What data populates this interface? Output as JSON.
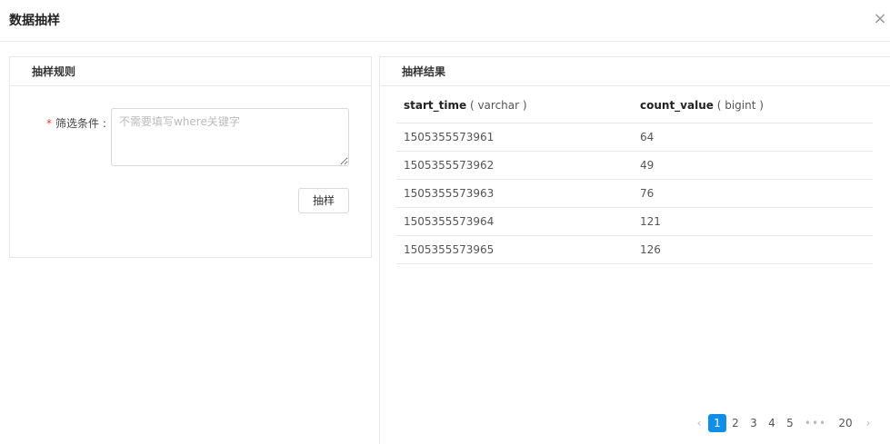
{
  "modal": {
    "title": "数据抽样",
    "close_icon": "×"
  },
  "rule_panel": {
    "title": "抽样规则",
    "field_label": "筛选条件 :",
    "required_mark": "*",
    "textarea_placeholder": "不需要填写where关键字",
    "sample_button": "抽样"
  },
  "result_panel": {
    "title": "抽样结果",
    "columns": [
      {
        "name": "start_time",
        "type": "( varchar )"
      },
      {
        "name": "count_value",
        "type": "( bigint )"
      }
    ],
    "rows": [
      [
        "1505355573961",
        "64"
      ],
      [
        "1505355573962",
        "49"
      ],
      [
        "1505355573963",
        "76"
      ],
      [
        "1505355573964",
        "121"
      ],
      [
        "1505355573965",
        "126"
      ]
    ]
  },
  "pagination": {
    "prev": "‹",
    "pages": [
      "1",
      "2",
      "3",
      "4",
      "5"
    ],
    "active_page": "1",
    "ellipsis": "•••",
    "last": "20",
    "next": "›"
  },
  "colors": {
    "accent": "#108ee9",
    "required": "#f04134",
    "border": "#e8e8e8"
  }
}
